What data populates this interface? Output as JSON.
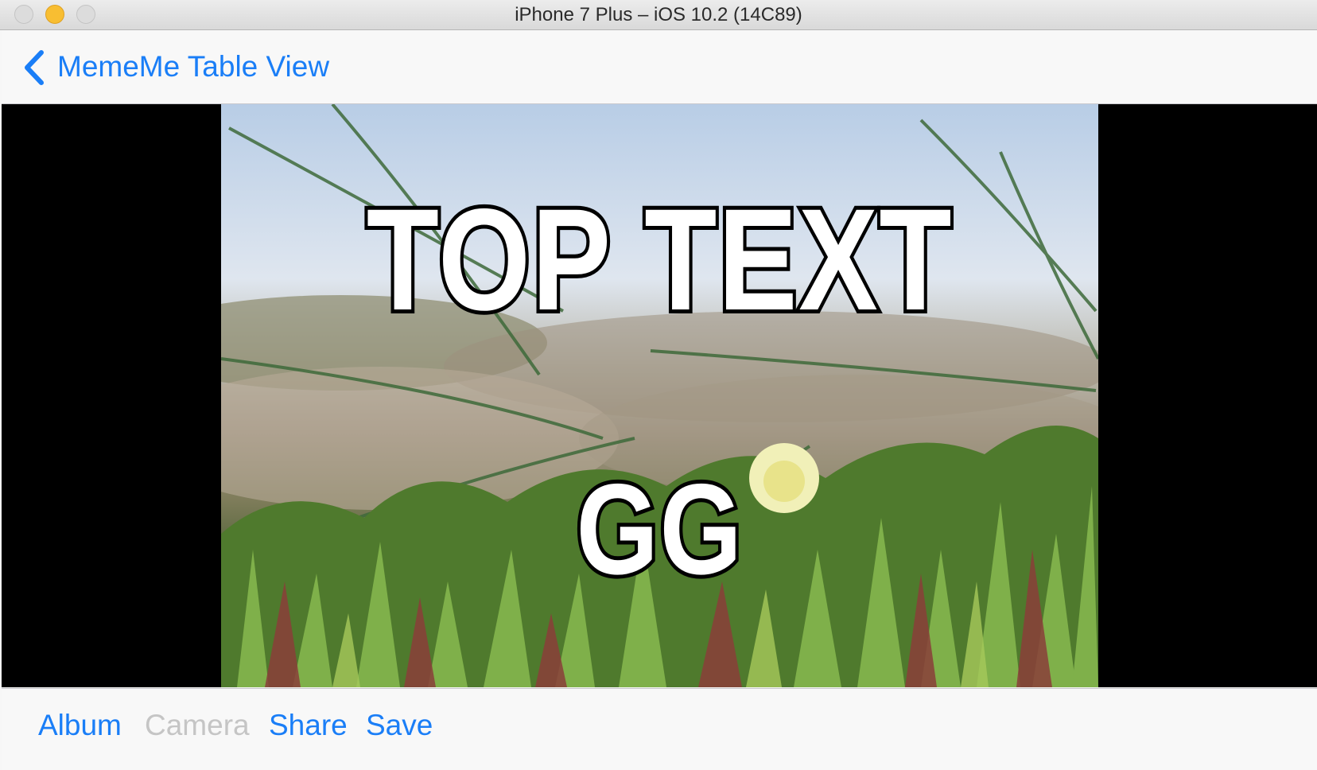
{
  "window": {
    "title": "iPhone 7 Plus – iOS 10.2 (14C89)"
  },
  "navbar": {
    "back_label": "MemeMe Table View",
    "back_icon": "chevron-left-icon"
  },
  "meme": {
    "top_text": "TOP TEXT",
    "bottom_text": "GG",
    "image": "beach-dune-ice-plants-photo"
  },
  "toolbar": {
    "album_label": "Album",
    "camera_label": "Camera",
    "share_label": "Share",
    "save_label": "Save",
    "camera_enabled": false
  },
  "colors": {
    "tint": "#1a7ef7",
    "disabled": "#c5c5c5"
  }
}
